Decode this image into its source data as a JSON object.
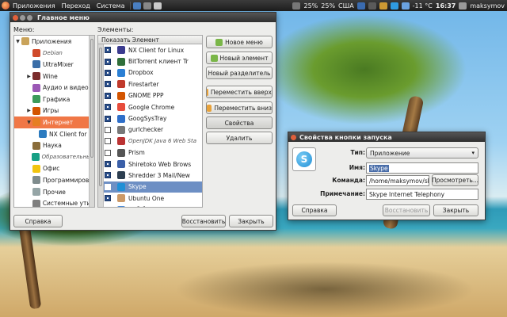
{
  "top_panel": {
    "menus": [
      "Приложения",
      "Переход",
      "Система"
    ],
    "battery1": "25%",
    "battery2": "25%",
    "keyboard_layout": "США",
    "temperature": "-11 °C",
    "time": "16:37",
    "user": "maksymov"
  },
  "menu_window": {
    "title": "Главное меню",
    "menus_label": "Меню:",
    "items_label": "Элементы:",
    "categories": [
      {
        "label": "Приложения",
        "level": 0,
        "arrow": "▼"
      },
      {
        "label": "Debian",
        "level": 1,
        "arrow": "",
        "italic": true
      },
      {
        "label": "UltraMixer",
        "level": 1,
        "arrow": ""
      },
      {
        "label": "Wine",
        "level": 1,
        "arrow": "▶"
      },
      {
        "label": "Аудио и видео",
        "level": 1,
        "arrow": ""
      },
      {
        "label": "Графика",
        "level": 1,
        "arrow": ""
      },
      {
        "label": "Игры",
        "level": 1,
        "arrow": "▶"
      },
      {
        "label": "Интернет",
        "level": 1,
        "arrow": "▼",
        "selected": true
      },
      {
        "label": "NX Client for",
        "level": 2,
        "arrow": ""
      },
      {
        "label": "Наука",
        "level": 1,
        "arrow": ""
      },
      {
        "label": "Образовательные",
        "level": 1,
        "arrow": "",
        "italic": true
      },
      {
        "label": "Офис",
        "level": 1,
        "arrow": ""
      },
      {
        "label": "Программирова",
        "level": 1,
        "arrow": ""
      },
      {
        "label": "Прочие",
        "level": 1,
        "arrow": ""
      },
      {
        "label": "Системные утил",
        "level": 1,
        "arrow": ""
      },
      {
        "label": "Специальные воз",
        "level": 1,
        "arrow": "",
        "italic": true
      }
    ],
    "list_header": {
      "show": "Показать",
      "item": "Элемент"
    },
    "items": [
      {
        "label": "NX Client for Linux",
        "checked": true
      },
      {
        "label": "BitTorrent клиент Tr",
        "checked": true
      },
      {
        "label": "Dropbox",
        "checked": true
      },
      {
        "label": "Firestarter",
        "checked": true
      },
      {
        "label": "GNOME PPP",
        "checked": true
      },
      {
        "label": "Google Chrome",
        "checked": true
      },
      {
        "label": "GoogSysTray",
        "checked": true
      },
      {
        "label": "gurlchecker",
        "checked": false
      },
      {
        "label": "OpenJDK Java 6 Web Sta",
        "checked": false,
        "italic": true
      },
      {
        "label": "Prism",
        "checked": false
      },
      {
        "label": "Shiretoko Web Brows",
        "checked": true
      },
      {
        "label": "Shredder 3 Mail/New",
        "checked": true
      },
      {
        "label": "Skype",
        "checked": true,
        "selected": true
      },
      {
        "label": "Ubuntu One",
        "checked": true
      },
      {
        "label": "Веб-браузер Epiphar",
        "checked": true
      }
    ],
    "buttons": {
      "new_menu": "Новое меню",
      "new_item": "Новый элемент",
      "new_separator": "Новый разделитель",
      "move_up": "Переместить вверх",
      "move_down": "Переместить вниз",
      "properties": "Свойства",
      "delete": "Удалить",
      "help": "Справка",
      "restore": "Восстановить",
      "close": "Закрыть"
    }
  },
  "launcher_dialog": {
    "title": "Свойства кнопки запуска",
    "type_label": "Тип:",
    "type_value": "Приложение",
    "name_label": "Имя:",
    "name_value": "Skype",
    "command_label": "Команда:",
    "command_value": "/home/maksymov/skyp",
    "browse": "Просмотреть...",
    "comment_label": "Примечание:",
    "comment_value": "Skype Internet Telephony",
    "help": "Справка",
    "restore": "Восстановить",
    "close": "Закрыть"
  },
  "colors": {
    "selected_category": "#f07746",
    "selected_item": "#6d8fc4",
    "name_highlight": "#4a6ea9"
  }
}
